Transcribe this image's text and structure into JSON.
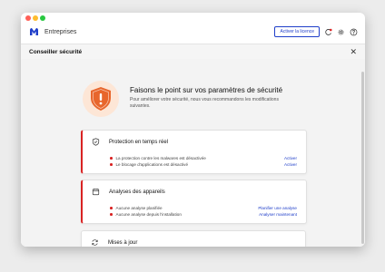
{
  "header": {
    "brand": "Entreprises",
    "license_button": "Activer la licence",
    "icons": [
      "alert-refresh-icon",
      "gear-icon",
      "help-icon"
    ]
  },
  "panel": {
    "title": "Conseiller sécurité"
  },
  "hero": {
    "title": "Faisons le point sur vos paramètres de sécurité",
    "subtitle": "Pour améliorer votre sécurité, nous vous recommandons les modifications suivantes."
  },
  "cards": [
    {
      "title": "Protection en temps réel",
      "icon": "shield-icon",
      "status": "warning",
      "items": [
        {
          "text": "La protection contre les malwares est désactivée",
          "action": "Activer"
        },
        {
          "text": "Le blocage d'applications est désactivé",
          "action": "Activer"
        }
      ]
    },
    {
      "title": "Analyses des appareils",
      "icon": "calendar-icon",
      "status": "warning",
      "items": [
        {
          "text": "Aucune analyse planifiée",
          "action": "Planifier une analyse"
        },
        {
          "text": "Aucune analyse depuis l'installation",
          "action": "Analyser maintenant"
        }
      ]
    },
    {
      "title": "Mises à jour",
      "icon": "refresh-icon",
      "status": "neutral",
      "items": []
    }
  ],
  "colors": {
    "accent": "#1f3ec9",
    "warning": "#d92323",
    "shield": "#e8662c"
  }
}
